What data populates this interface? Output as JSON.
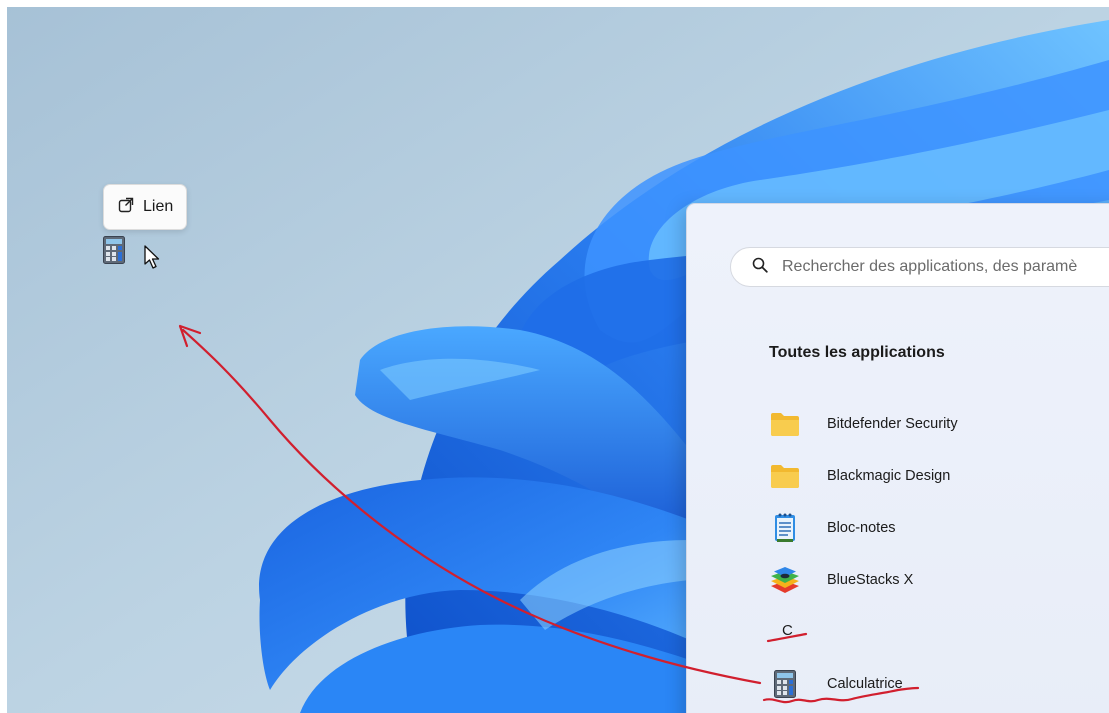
{
  "drag": {
    "tooltip_label": "Lien",
    "tooltip_icon": "external-link-icon",
    "ghost_icon": "calculator-icon",
    "cursor_icon": "pointer-cursor-icon"
  },
  "start_menu": {
    "search": {
      "placeholder": "Rechercher des applications, des paramè",
      "icon": "search-icon"
    },
    "section_title": "Toutes les applications",
    "apps": [
      {
        "label": "Bitdefender Security",
        "icon": "folder-icon"
      },
      {
        "label": "Blackmagic Design",
        "icon": "folder-icon"
      },
      {
        "label": "Bloc-notes",
        "icon": "notepad-icon"
      },
      {
        "label": "BlueStacks X",
        "icon": "bluestacks-icon"
      }
    ],
    "letter_header": "C",
    "apps_c": [
      {
        "label": "Calculatrice",
        "icon": "calculator-icon"
      }
    ]
  },
  "colors": {
    "annotation_red": "#d11f2e",
    "folder_yellow": "#f5c542",
    "wallpaper_blue": "#2f7ff0",
    "wallpaper_bg": "#b6cee0"
  }
}
